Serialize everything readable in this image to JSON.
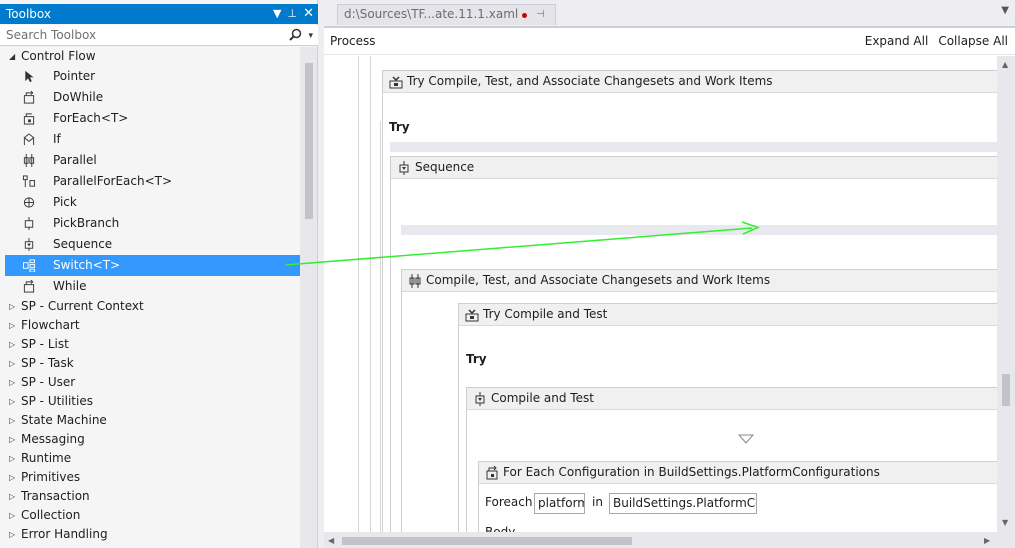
{
  "toolbox": {
    "title": "Toolbox",
    "search_placeholder": "Search Toolbox",
    "control_flow_label": "Control Flow",
    "items": [
      {
        "label": "Pointer",
        "icon": "pointer-icon"
      },
      {
        "label": "DoWhile",
        "icon": "dowhile-icon"
      },
      {
        "label": "ForEach<T>",
        "icon": "foreach-icon"
      },
      {
        "label": "If",
        "icon": "if-icon"
      },
      {
        "label": "Parallel",
        "icon": "parallel-icon"
      },
      {
        "label": "ParallelForEach<T>",
        "icon": "parallelforeach-icon"
      },
      {
        "label": "Pick",
        "icon": "pick-icon"
      },
      {
        "label": "PickBranch",
        "icon": "pickbranch-icon"
      },
      {
        "label": "Sequence",
        "icon": "sequence-icon"
      },
      {
        "label": "Switch<T>",
        "icon": "switch-icon",
        "selected": true
      },
      {
        "label": "While",
        "icon": "while-icon"
      }
    ],
    "categories": [
      "SP - Current Context",
      "Flowchart",
      "SP - List",
      "SP - Task",
      "SP - User",
      "SP - Utilities",
      "State Machine",
      "Messaging",
      "Runtime",
      "Primitives",
      "Transaction",
      "Collection",
      "Error Handling"
    ]
  },
  "editor": {
    "tab_title": "d:\\Sources\\TF...ate.11.1.xaml",
    "breadcrumb": "Process",
    "expand_all": "Expand All",
    "collapse_all": "Collapse All"
  },
  "workflow": {
    "try_compile_associate": "Try Compile, Test, and Associate Changesets and Work Items",
    "try_label": "Try",
    "sequence": "Sequence",
    "compile_associate": "Compile, Test, and Associate Changesets and Work Items",
    "try_compile_test": "Try Compile and Test",
    "try_label_2": "Try",
    "compile_and_test": "Compile and Test",
    "for_each": "For Each Configuration in BuildSettings.PlatformConfigurations",
    "foreach_keyword": "Foreach",
    "foreach_var": "platform",
    "in_keyword": "in",
    "foreach_collection": "BuildSettings.PlatformCor",
    "body_label": "Body"
  },
  "colors": {
    "accent": "#007acc",
    "selection": "#3399ff",
    "drag_arrow": "#33ee33"
  }
}
